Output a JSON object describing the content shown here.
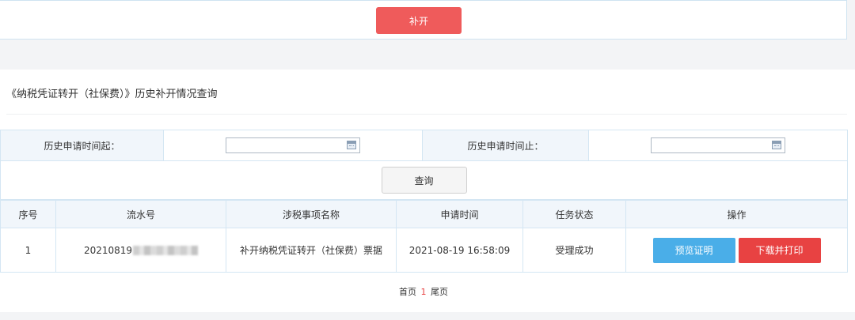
{
  "top": {
    "reissue_label": "补开"
  },
  "page_title": "《纳税凭证转开（社保费）》历史补开情况查询",
  "filter": {
    "start_label": "历史申请时间起：",
    "start_value": "",
    "end_label": "历史申请时间止：",
    "end_value": "",
    "query_label": "查询"
  },
  "table": {
    "headers": [
      "序号",
      "流水号",
      "涉税事项名称",
      "申请时间",
      "任务状态",
      "操作"
    ],
    "rows": [
      {
        "index": "1",
        "serial": "20210819",
        "item_name": "补开纳税凭证转开（社保费）票据",
        "apply_time": "2021-08-19 16:58:09",
        "status": "受理成功",
        "preview_label": "预览证明",
        "download_label": "下载并打印"
      }
    ]
  },
  "pager": {
    "first": "首页",
    "current": "1",
    "last": "尾页"
  },
  "colors": {
    "reissue": "#ef5b5b",
    "preview": "#4aaee8",
    "download": "#e84242",
    "header_bg": "#f1f6fb",
    "border": "#d4e6f3"
  }
}
